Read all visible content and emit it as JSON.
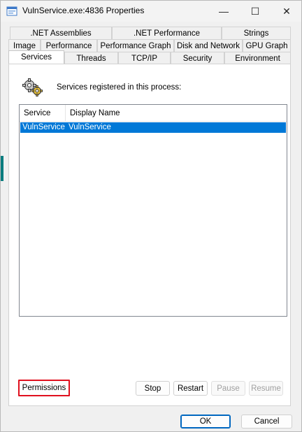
{
  "window": {
    "title": "VulnService.exe:4836 Properties",
    "controls": {
      "minimize": "—",
      "maximize": "☐",
      "close": "✕"
    }
  },
  "tabs": {
    "row1": [
      ".NET Assemblies",
      ".NET Performance",
      "Strings"
    ],
    "row2": [
      "Image",
      "Performance",
      "Performance Graph",
      "Disk and Network",
      "GPU Graph"
    ],
    "row3": [
      "Services",
      "Threads",
      "TCP/IP",
      "Security",
      "Environment"
    ],
    "selected": "Services"
  },
  "services_panel": {
    "caption": "Services registered in this process:",
    "icon": "gears-icon",
    "columns": [
      "Service",
      "Display Name"
    ],
    "rows": [
      {
        "service": "VulnService",
        "display_name": "VulnService",
        "selected": true
      }
    ]
  },
  "buttons": {
    "permissions": "Permissions",
    "stop": "Stop",
    "restart": "Restart",
    "pause": "Pause",
    "resume": "Resume",
    "ok": "OK",
    "cancel": "Cancel"
  },
  "colors": {
    "selection": "#0078d7",
    "highlight_border": "#e0101e",
    "accent": "#0067c0"
  }
}
